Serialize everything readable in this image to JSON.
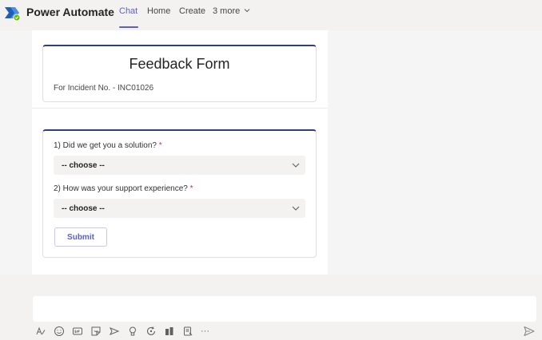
{
  "header": {
    "app_title": "Power Automate",
    "tabs": [
      {
        "label": "Chat",
        "active": true
      },
      {
        "label": "Home",
        "active": false
      },
      {
        "label": "Create",
        "active": false
      },
      {
        "label": "3 more",
        "active": false
      }
    ]
  },
  "card": {
    "title": "Feedback Form",
    "subtitle": "For Incident No. - INC01026",
    "questions": [
      {
        "label": "1) Did we get you a solution?",
        "required_mark": "*",
        "selected": "-- choose --"
      },
      {
        "label": "2) How was your support experience?",
        "required_mark": "*",
        "selected": "-- choose --"
      }
    ],
    "submit_label": "Submit"
  },
  "compose": {
    "toolbar_icons": [
      "format-icon",
      "emoji-icon",
      "gif-icon",
      "sticker-icon",
      "meet-icon",
      "praise-icon",
      "loop-icon",
      "approvals-icon",
      "updates-icon",
      "more-options-icon"
    ],
    "more_label": "···"
  },
  "colors": {
    "accent": "#5b5fc7",
    "card_bar": "#2f3f7a",
    "required": "#c4314b"
  }
}
